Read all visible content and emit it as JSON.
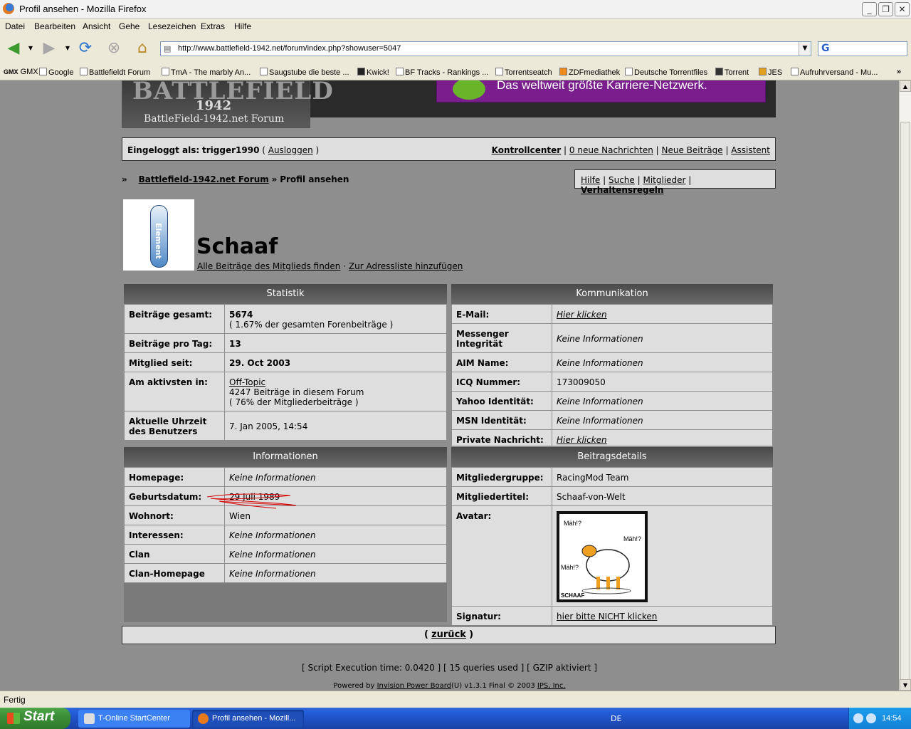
{
  "window": {
    "title": "Profil ansehen - Mozilla Firefox"
  },
  "menu": [
    "Datei",
    "Bearbeiten",
    "Ansicht",
    "Gehe",
    "Lesezeichen",
    "Extras",
    "Hilfe"
  ],
  "url": "http://www.battlefield-1942.net/forum/index.php?showuser=5047",
  "bookmarks": [
    "GMX",
    "Google",
    "Battlefieldt Forum",
    "TmA - The marbly An...",
    "Saugstube die beste ...",
    "Kwick!",
    "BF Tracks - Rankings ...",
    "Torrentseatch",
    "ZDFmediathek",
    "Deutsche Torrentfiles",
    "Torrent",
    "JES",
    "Aufruhrversand - Mu..."
  ],
  "banner": {
    "logo_big": "BATTLEFIELD",
    "logo_year": "1942",
    "logo_sub": "BattleField-1942.net Forum",
    "ad_text": "Das weltweit größte Karriere-Netzwerk."
  },
  "userbar": {
    "logged_prefix": "Eingeloggt als:",
    "user": "trigger1990",
    "logout": "Ausloggen",
    "links": [
      "Kontrollcenter",
      "0 neue Nachrichten",
      "Neue Beiträge",
      "Assistent"
    ]
  },
  "crumb": {
    "arrow": "»",
    "forum": "Battlefield-1942.net Forum",
    "sep": "»",
    "page": "Profil ansehen"
  },
  "help_links": [
    "Hilfe",
    "Suche",
    "Mitglieder",
    "Verhaltensregeln"
  ],
  "profile": {
    "board_text": "Element",
    "name": "Schaaf",
    "link_posts": "Alle Beiträge des Mitglieds finden",
    "sep": "·",
    "link_addr": "Zur Adressliste hinzufügen"
  },
  "stats": {
    "title": "Statistik",
    "rows": [
      {
        "k": "Beiträge gesamt:",
        "v1": "5674",
        "v2": "( 1.67% der gesamten Forenbeiträge )"
      },
      {
        "k": "Beiträge pro Tag:",
        "v1": "13"
      },
      {
        "k": "Mitglied seit:",
        "v1": "29. Oct 2003"
      },
      {
        "k": "Am aktivsten in:",
        "v1": "Off-Topic",
        "v2": "4247 Beiträge in diesem Forum",
        "v3": "( 76% der Mitgliederbeiträge )"
      },
      {
        "k": "Aktuelle Uhrzeit des Benutzers",
        "v1": "7. Jan 2005, 14:54"
      }
    ]
  },
  "comm": {
    "title": "Kommunikation",
    "rows": [
      {
        "k": "E-Mail:",
        "v": "Hier klicken"
      },
      {
        "k": "Messenger Integrität",
        "v": "Keine Informationen"
      },
      {
        "k": "AIM Name:",
        "v": "Keine Informationen"
      },
      {
        "k": "ICQ Nummer:",
        "v": "173009050"
      },
      {
        "k": "Yahoo Identität:",
        "v": "Keine Informationen"
      },
      {
        "k": "MSN Identität:",
        "v": "Keine Informationen"
      },
      {
        "k": "Private Nachricht:",
        "v": "Hier klicken"
      }
    ]
  },
  "info": {
    "title": "Informationen",
    "rows": [
      {
        "k": "Homepage:",
        "v": "Keine Informationen"
      },
      {
        "k": "Geburtsdatum:",
        "v": "29 Juli 1989"
      },
      {
        "k": "Wohnort:",
        "v": "Wien"
      },
      {
        "k": "Interessen:",
        "v": "Keine Informationen"
      },
      {
        "k": "Clan",
        "v": "Keine Informationen"
      },
      {
        "k": "Clan-Homepage",
        "v": "Keine Informationen"
      }
    ]
  },
  "details": {
    "title": "Beitragsdetails",
    "group_k": "Mitgliedergruppe:",
    "group_v": "RacingMod Team",
    "title_k": "Mitgliedertitel:",
    "title_v": "Schaaf-von-Welt",
    "avatar_k": "Avatar:",
    "sheep_a": "Mäh!?",
    "sheep_b": "Mäh!?",
    "sheep_c": "Mäh!?",
    "sheep_sig": "SCHAAF",
    "sig_k": "Signatur:",
    "sig_v": "hier bitte NICHT klicken"
  },
  "back": {
    "open": "(",
    "label": "zurück",
    "close": ")"
  },
  "footer": {
    "line1": "[ Script Execution time: 0.0420 ]   [ 15 queries used ]   [ GZIP aktiviert ]",
    "powered": "Powered by",
    "ipb": "Invision Power Board",
    "ver": "(U) v1.3.1 Final © 2003",
    "ips": "IPS, Inc."
  },
  "status": "Fertig",
  "taskbar": {
    "start": "Start",
    "t1": "T-Online StartCenter",
    "t2": "Profil ansehen - Mozill...",
    "lang": "DE",
    "clock": "14:54"
  }
}
